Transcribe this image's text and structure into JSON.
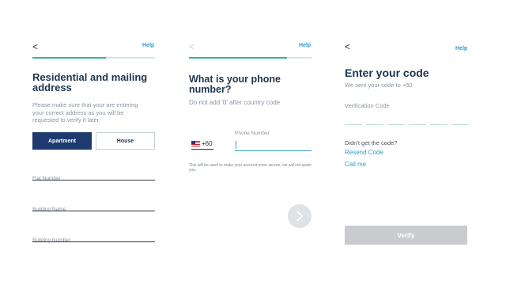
{
  "screen1": {
    "back_icon": "chevron-left-icon",
    "back_glyph": "<",
    "help": "Help",
    "progress": 0.6,
    "title": "Residential and mailing address",
    "subtitle": "Please make sure that your are entering your correct address as you will be requested to verify it later.",
    "options": [
      "Apartment",
      "House"
    ],
    "selected_option": "Apartment",
    "fields": [
      {
        "placeholder": "Flat Number",
        "value": ""
      },
      {
        "placeholder": "Building Name",
        "value": ""
      },
      {
        "placeholder": "Building Number",
        "value": ""
      }
    ]
  },
  "screen2": {
    "back_icon": "chevron-left-icon",
    "back_glyph": "<",
    "help": "Help",
    "progress": 0.8,
    "title": "What is your phone number?",
    "subtitle": "Do not add '0' after country code",
    "country_flag": "malaysia-flag-icon",
    "country_code": "+60",
    "phone_label": "Phone Number",
    "phone_value": "",
    "note": "This will be used to make your account more secure, we will not spam you.",
    "next_icon": "chevron-right-icon"
  },
  "screen3": {
    "back_icon": "chevron-left-icon",
    "back_glyph": "<",
    "help": "Help",
    "title": "Enter your code",
    "subtitle": "We sent your code to +60",
    "code_label": "Verification Code",
    "code_length": 6,
    "didnt_get": "Didn't get the code?",
    "resend": "Resend Code",
    "call": "Call me",
    "verify": "Verify"
  },
  "colors": {
    "navy": "#1e3a6e",
    "teal": "#2fb894",
    "link_blue": "#2d9bd0",
    "disabled_grey": "#c9cbcf"
  }
}
